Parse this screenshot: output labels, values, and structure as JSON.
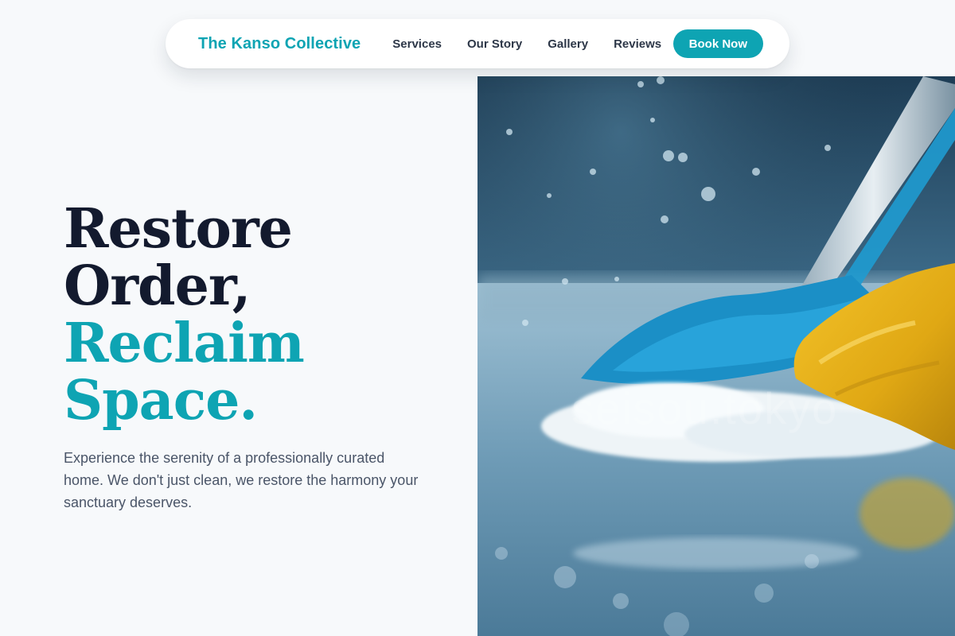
{
  "nav": {
    "brand": "The Kanso Collective",
    "links": [
      "Services",
      "Our Story",
      "Gallery",
      "Reviews"
    ],
    "cta": "Book Now"
  },
  "hero": {
    "title_line1": "Restore",
    "title_line2": "Order,",
    "title_line3": "Reclaim",
    "title_line4": "Space.",
    "subtitle": "Experience the serenity of a professionally curated home. We don't just clean, we restore the harmony your sanctuary deserves.",
    "image_watermark": "seisou.tokyo"
  },
  "colors": {
    "accent": "#0ea4b3",
    "heading": "#131a2e",
    "body_text": "#4a5568",
    "background": "#f7f9fb"
  }
}
